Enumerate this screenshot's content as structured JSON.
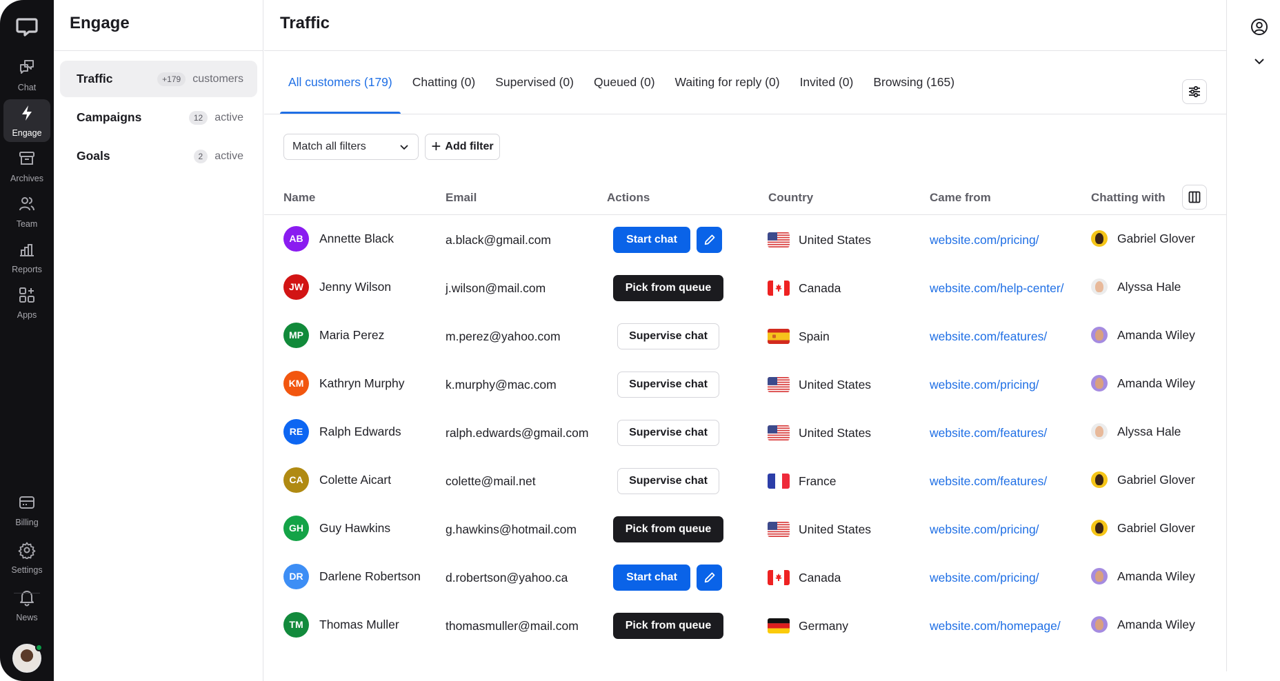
{
  "rail": {
    "items": [
      {
        "label": "Chat",
        "icon": "chat-bubbles-icon"
      },
      {
        "label": "Engage",
        "icon": "lightning-icon",
        "active": true
      },
      {
        "label": "Archives",
        "icon": "archive-box-icon"
      },
      {
        "label": "Team",
        "icon": "users-icon"
      },
      {
        "label": "Reports",
        "icon": "bar-chart-icon"
      },
      {
        "label": "Apps",
        "icon": "apps-grid-icon"
      }
    ],
    "bottom_items": [
      {
        "label": "Billing",
        "icon": "credit-card-icon"
      },
      {
        "label": "Settings",
        "icon": "gear-icon"
      },
      {
        "label": "News",
        "icon": "bell-icon"
      }
    ]
  },
  "subnav": {
    "title": "Engage",
    "items": [
      {
        "name": "Traffic",
        "badge": "+179",
        "meta": "customers",
        "active": true
      },
      {
        "name": "Campaigns",
        "badge": "12",
        "meta": "active"
      },
      {
        "name": "Goals",
        "badge": "2",
        "meta": "active"
      }
    ]
  },
  "main": {
    "title": "Traffic",
    "tabs": [
      {
        "label": "All customers (179)",
        "active": true
      },
      {
        "label": "Chatting (0)"
      },
      {
        "label": "Supervised (0)"
      },
      {
        "label": "Queued (0)"
      },
      {
        "label": "Waiting for reply (0)"
      },
      {
        "label": "Invited (0)"
      },
      {
        "label": "Browsing (165)"
      }
    ],
    "filter": {
      "select_value": "Match all filters",
      "add_label": "Add filter"
    },
    "columns": [
      "Name",
      "Email",
      "Actions",
      "Country",
      "Came from",
      "Chatting with"
    ],
    "rows": [
      {
        "initials": "AB",
        "color": "#8a1cf0",
        "name": "Annette Black",
        "email": "a.black@gmail.com",
        "action": "start",
        "action_label": "Start chat",
        "country": "United States",
        "flag": "us",
        "came_from": "website.com/pricing/",
        "agent": "Gabriel Glover"
      },
      {
        "initials": "JW",
        "color": "#d21414",
        "name": "Jenny Wilson",
        "email": "j.wilson@mail.com",
        "action": "queue",
        "action_label": "Pick from queue",
        "country": "Canada",
        "flag": "ca",
        "came_from": "website.com/help-center/",
        "agent": "Alyssa Hale"
      },
      {
        "initials": "MP",
        "color": "#118a3a",
        "name": "Maria Perez",
        "email": "m.perez@yahoo.com",
        "action": "supervise",
        "action_label": "Supervise chat",
        "country": "Spain",
        "flag": "es",
        "came_from": "website.com/features/",
        "agent": "Amanda Wiley"
      },
      {
        "initials": "KM",
        "color": "#f2560f",
        "name": "Kathryn Murphy",
        "email": "k.murphy@mac.com",
        "action": "supervise",
        "action_label": "Supervise chat",
        "country": "United States",
        "flag": "us",
        "came_from": "website.com/pricing/",
        "agent": "Amanda Wiley"
      },
      {
        "initials": "RE",
        "color": "#0d66f2",
        "name": "Ralph Edwards",
        "email": "ralph.edwards@gmail.com",
        "action": "supervise",
        "action_label": "Supervise chat",
        "country": "United States",
        "flag": "us",
        "came_from": "website.com/features/",
        "agent": "Alyssa Hale"
      },
      {
        "initials": "CA",
        "color": "#b08a12",
        "name": "Colette Aicart",
        "email": "colette@mail.net",
        "action": "supervise",
        "action_label": "Supervise chat",
        "country": "France",
        "flag": "fr",
        "came_from": "website.com/features/",
        "agent": "Gabriel Glover"
      },
      {
        "initials": "GH",
        "color": "#14a347",
        "name": "Guy Hawkins",
        "email": "g.hawkins@hotmail.com",
        "action": "queue",
        "action_label": "Pick from queue",
        "country": "United States",
        "flag": "us",
        "came_from": "website.com/pricing/",
        "agent": "Gabriel Glover"
      },
      {
        "initials": "DR",
        "color": "#3d8ef5",
        "name": "Darlene Robertson",
        "email": "d.robertson@yahoo.ca",
        "action": "start",
        "action_label": "Start chat",
        "country": "Canada",
        "flag": "ca",
        "came_from": "website.com/pricing/",
        "agent": "Amanda Wiley"
      },
      {
        "initials": "TM",
        "color": "#128a3c",
        "name": "Thomas Muller",
        "email": "thomasmuller@mail.com",
        "action": "queue",
        "action_label": "Pick from queue",
        "country": "Germany",
        "flag": "de",
        "came_from": "website.com/homepage/",
        "agent": "Amanda Wiley"
      }
    ]
  },
  "agents": {
    "Gabriel Glover": {
      "bg": "#f5c518",
      "face": "#3b2416"
    },
    "Alyssa Hale": {
      "bg": "#ececec",
      "face": "#e8b99a"
    },
    "Amanda Wiley": {
      "bg": "#a58be0",
      "face": "#d9a07f"
    }
  },
  "colors": {
    "accent": "#1f6fe5",
    "rail_bg": "#111114",
    "queue_btn": "#1b1b1f",
    "start_btn": "#0a63e8"
  }
}
